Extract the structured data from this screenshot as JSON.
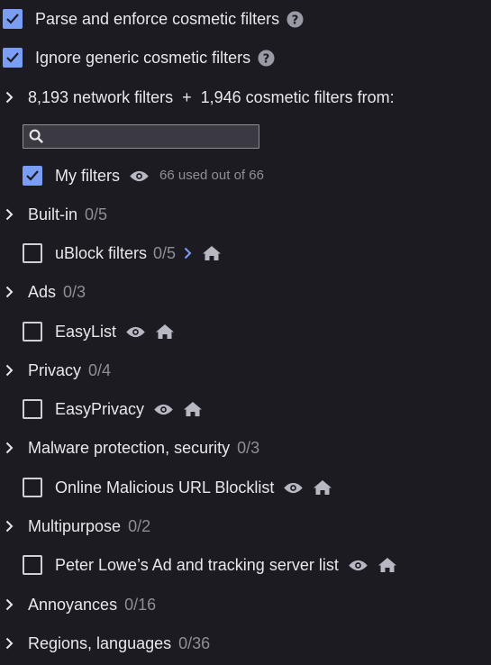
{
  "settings": {
    "parse_cosmetic": {
      "label": "Parse and enforce cosmetic filters",
      "checked": true,
      "help_icon": "question-circle-icon"
    },
    "ignore_generic": {
      "label": "Ignore generic cosmetic filters",
      "checked": true,
      "help_icon": "question-circle-icon"
    }
  },
  "summary": {
    "network_count": "8,193",
    "network_label": "network filters",
    "plus": "+",
    "cosmetic_count": "1,946",
    "cosmetic_label": "cosmetic filters from:"
  },
  "search": {
    "placeholder": "",
    "value": "",
    "icon": "search-icon"
  },
  "my_filters": {
    "label": "My filters",
    "checked": true,
    "usage": "66 used out of 66",
    "icon": "eye-icon"
  },
  "groups": [
    {
      "label": "Built-in",
      "count": "0/5",
      "items": [
        {
          "label": "uBlock filters",
          "count": "0/5",
          "checked": false,
          "icons": [
            "chevron-right-icon",
            "home-icon"
          ]
        }
      ]
    },
    {
      "label": "Ads",
      "count": "0/3",
      "items": [
        {
          "label": "EasyList",
          "checked": false,
          "icons": [
            "eye-icon",
            "home-icon"
          ]
        }
      ]
    },
    {
      "label": "Privacy",
      "count": "0/4",
      "items": [
        {
          "label": "EasyPrivacy",
          "checked": false,
          "icons": [
            "eye-icon",
            "home-icon"
          ]
        }
      ]
    },
    {
      "label": "Malware protection, security",
      "count": "0/3",
      "items": [
        {
          "label": "Online Malicious URL Blocklist",
          "checked": false,
          "icons": [
            "eye-icon",
            "home-icon"
          ]
        }
      ]
    },
    {
      "label": "Multipurpose",
      "count": "0/2",
      "items": [
        {
          "label": "Peter Lowe’s Ad and tracking server list",
          "checked": false,
          "icons": [
            "eye-icon",
            "home-icon"
          ]
        }
      ]
    },
    {
      "label": "Annoyances",
      "count": "0/16",
      "items": []
    },
    {
      "label": "Regions, languages",
      "count": "0/36",
      "items": []
    }
  ],
  "colors": {
    "background": "#1c1b22",
    "accent": "#7b9ef5",
    "text": "#e8e8ec",
    "muted": "#8e8e98",
    "icon": "#cfcfd8"
  }
}
